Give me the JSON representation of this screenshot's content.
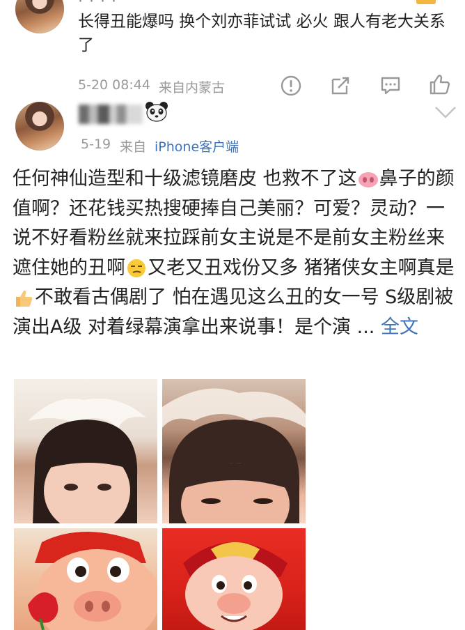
{
  "comment": {
    "text": "长得丑能爆吗 换个刘亦菲试试 必火 跟人有老大关系了",
    "time": "5-20 08:44",
    "location": "来自内蒙古"
  },
  "post": {
    "date": "5-19",
    "source_prefix": "来自",
    "source_client": "iPhone客户端",
    "segments": [
      "任何神仙造型和十级滤镜磨皮 也救不了这",
      "鼻子的颜值啊？还花钱买热搜硬捧自己美丽？可爱？灵动？一说不好看粉丝就来拉踩前女主说是不是前女主粉丝来遮住她的丑啊",
      "又老又丑戏份又多 猪猪侠女主啊真是",
      "不敢看古偶剧了 怕在遇见这么丑的女一号 S级剧被演出A级 对着绿幕演拿出来说事！是个演 ... "
    ],
    "full_text_link": "全文"
  },
  "icons": [
    "report-icon",
    "share-icon",
    "comment-icon",
    "like-icon",
    "panda-icon",
    "chevron-down-icon",
    "pig-nose-emoji",
    "smirk-emoji",
    "thumbs-up-emoji"
  ],
  "colors": {
    "link": "#3e73b8",
    "meta": "#9a9a9a",
    "text": "#222222"
  }
}
